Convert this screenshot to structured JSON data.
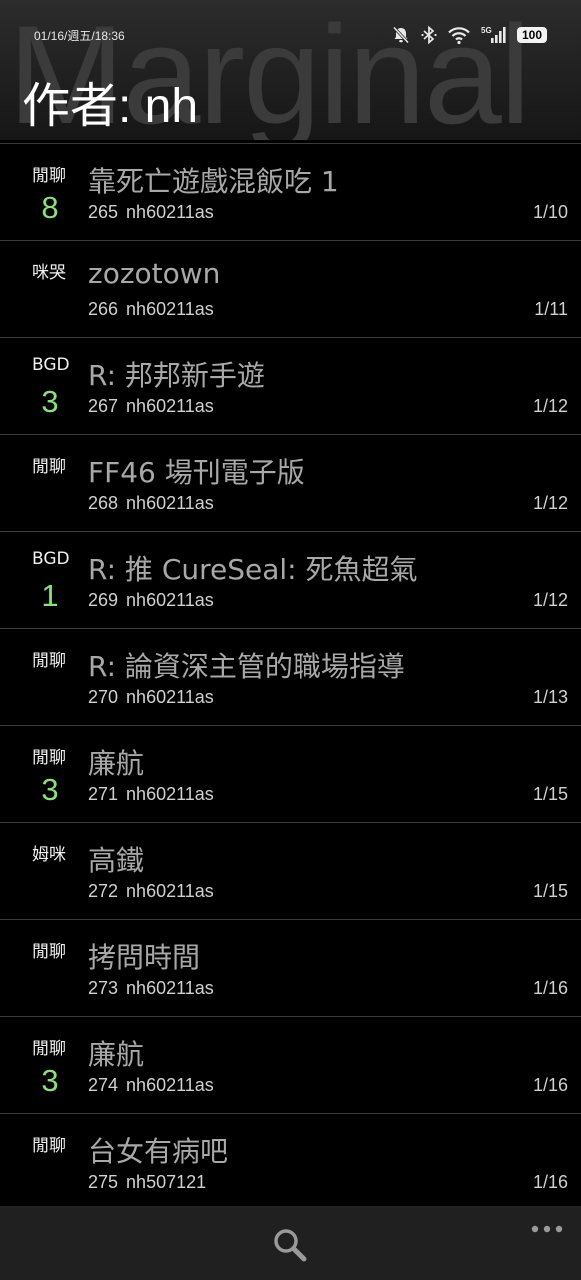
{
  "status_bar": {
    "time": "01/16/週五/18:36",
    "battery": "100",
    "icons": [
      "bell-off-icon",
      "bluetooth-icon",
      "wifi-icon",
      "signal-5g-icon",
      "battery-icon"
    ]
  },
  "header": {
    "watermark": "Marginal",
    "title": "作者: nh"
  },
  "posts": [
    {
      "board": "閒聊",
      "count": "8",
      "subject": "靠死亡遊戲混飯吃 1",
      "number": "265",
      "author": "nh60211as",
      "date": "1/10"
    },
    {
      "board": "咪哭",
      "count": "",
      "subject": "zozotown",
      "number": "266",
      "author": "nh60211as",
      "date": "1/11"
    },
    {
      "board": "BGD",
      "count": "3",
      "subject": "R: 邦邦新手遊",
      "number": "267",
      "author": "nh60211as",
      "date": "1/12"
    },
    {
      "board": "閒聊",
      "count": "",
      "subject": "FF46 場刊電子版",
      "number": "268",
      "author": "nh60211as",
      "date": "1/12"
    },
    {
      "board": "BGD",
      "count": "1",
      "subject": "R: 推 CureSeal: 死魚超氣",
      "number": "269",
      "author": "nh60211as",
      "date": "1/12"
    },
    {
      "board": "閒聊",
      "count": "",
      "subject": "R:  論資深主管的職場指導",
      "number": "270",
      "author": "nh60211as",
      "date": "1/13"
    },
    {
      "board": "閒聊",
      "count": "3",
      "subject": "廉航",
      "number": "271",
      "author": "nh60211as",
      "date": "1/15"
    },
    {
      "board": "姆咪",
      "count": "",
      "subject": "高鐵",
      "number": "272",
      "author": "nh60211as",
      "date": "1/15"
    },
    {
      "board": "閒聊",
      "count": "",
      "subject": "拷問時間",
      "number": "273",
      "author": "nh60211as",
      "date": "1/16"
    },
    {
      "board": "閒聊",
      "count": "3",
      "subject": "廉航",
      "number": "274",
      "author": "nh60211as",
      "date": "1/16"
    },
    {
      "board": "閒聊",
      "count": "",
      "subject": "台女有病吧",
      "number": "275",
      "author": "nh507121",
      "date": "1/16"
    }
  ],
  "toolbar": {
    "search_icon": "search-icon",
    "more_icon": "more-icon"
  },
  "colors": {
    "accent_count": "#8ae07a",
    "subject_text": "#a8a8a8",
    "background": "#000000"
  }
}
